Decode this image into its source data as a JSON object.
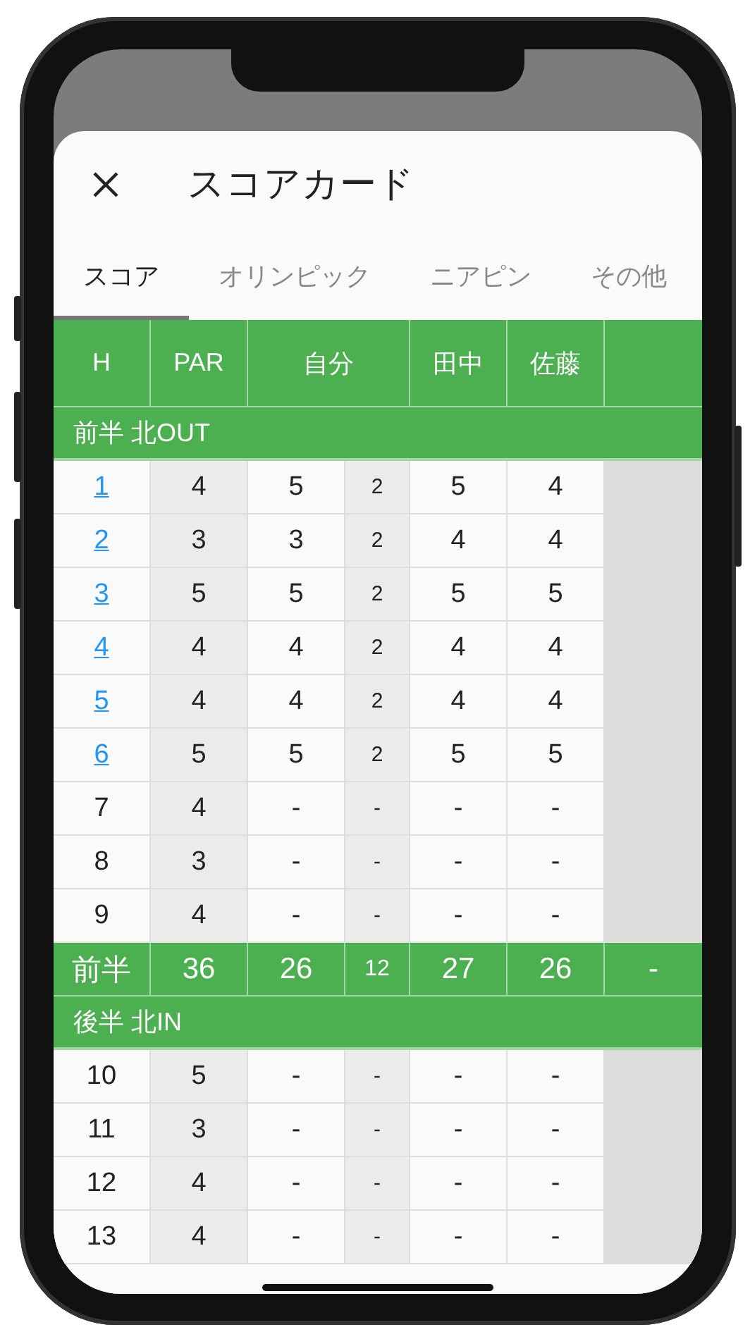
{
  "header": {
    "title": "スコアカード"
  },
  "tabs": [
    {
      "label": "スコア",
      "selected": true
    },
    {
      "label": "オリンピック",
      "selected": false
    },
    {
      "label": "ニアピン",
      "selected": false
    },
    {
      "label": "その他",
      "selected": false
    }
  ],
  "table": {
    "columns": [
      {
        "label": "H",
        "kind": "normal"
      },
      {
        "label": "PAR",
        "kind": "normal"
      },
      {
        "label": "自分",
        "kind": "wide"
      },
      {
        "label": "田中",
        "kind": "normal"
      },
      {
        "label": "佐藤",
        "kind": "normal"
      }
    ],
    "sections": [
      {
        "title": "前半 北OUT",
        "rows": [
          {
            "hole": "1",
            "link": true,
            "values": [
              "4",
              "5",
              "2",
              "5",
              "4"
            ]
          },
          {
            "hole": "2",
            "link": true,
            "values": [
              "3",
              "3",
              "2",
              "4",
              "4"
            ]
          },
          {
            "hole": "3",
            "link": true,
            "values": [
              "5",
              "5",
              "2",
              "5",
              "5"
            ]
          },
          {
            "hole": "4",
            "link": true,
            "values": [
              "4",
              "4",
              "2",
              "4",
              "4"
            ]
          },
          {
            "hole": "5",
            "link": true,
            "values": [
              "4",
              "4",
              "2",
              "4",
              "4"
            ]
          },
          {
            "hole": "6",
            "link": true,
            "values": [
              "5",
              "5",
              "2",
              "5",
              "5"
            ]
          },
          {
            "hole": "7",
            "link": false,
            "values": [
              "4",
              "-",
              "-",
              "-",
              "-"
            ]
          },
          {
            "hole": "8",
            "link": false,
            "values": [
              "3",
              "-",
              "-",
              "-",
              "-"
            ]
          },
          {
            "hole": "9",
            "link": false,
            "values": [
              "4",
              "-",
              "-",
              "-",
              "-"
            ]
          }
        ],
        "total": {
          "label": "前半",
          "values": [
            "36",
            "26",
            "12",
            "27",
            "26",
            "-"
          ]
        }
      },
      {
        "title": "後半 北IN",
        "rows": [
          {
            "hole": "10",
            "link": false,
            "values": [
              "5",
              "-",
              "-",
              "-",
              "-"
            ]
          },
          {
            "hole": "11",
            "link": false,
            "values": [
              "3",
              "-",
              "-",
              "-",
              "-"
            ]
          },
          {
            "hole": "12",
            "link": false,
            "values": [
              "4",
              "-",
              "-",
              "-",
              "-"
            ]
          },
          {
            "hole": "13",
            "link": false,
            "values": [
              "4",
              "-",
              "-",
              "-",
              "-"
            ]
          }
        ]
      }
    ]
  }
}
